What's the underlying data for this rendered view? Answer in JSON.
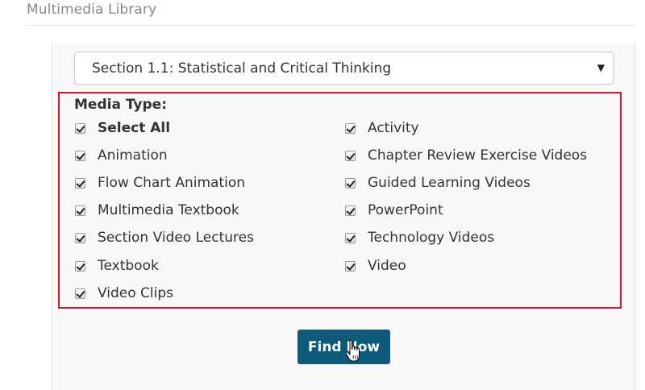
{
  "page": {
    "title": "Multimedia Library"
  },
  "filters": {
    "section_select": {
      "selected": "Section 1.1: Statistical and Critical Thinking"
    },
    "media_type": {
      "label": "Media Type:",
      "options": [
        {
          "label": "Select All",
          "checked": true
        },
        {
          "label": "Animation",
          "checked": true
        },
        {
          "label": "Flow Chart Animation",
          "checked": true
        },
        {
          "label": "Multimedia Textbook",
          "checked": true
        },
        {
          "label": "Section Video Lectures",
          "checked": true
        },
        {
          "label": "Textbook",
          "checked": true
        },
        {
          "label": "Video Clips",
          "checked": true
        },
        {
          "label": "Activity",
          "checked": true
        },
        {
          "label": "Chapter Review Exercise Videos",
          "checked": true
        },
        {
          "label": "Guided Learning Videos",
          "checked": true
        },
        {
          "label": "PowerPoint",
          "checked": true
        },
        {
          "label": "Technology Videos",
          "checked": true
        },
        {
          "label": "Video",
          "checked": true
        }
      ]
    },
    "find_button": {
      "label": "Find Now"
    }
  },
  "colors": {
    "highlight_border": "#e0101c",
    "button_bg": "#0d5a7a"
  },
  "icons": {
    "select_caret": "caret-down-icon",
    "cursor": "hand-pointer-icon"
  }
}
